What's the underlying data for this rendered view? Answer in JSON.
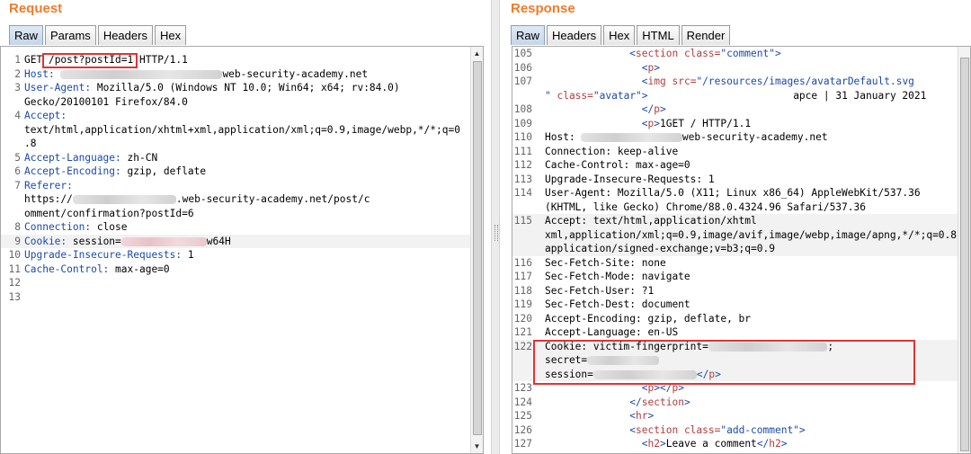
{
  "request": {
    "title": "Request",
    "tabs": [
      "Raw",
      "Params",
      "Headers",
      "Hex"
    ],
    "lines": [
      {
        "n": "1",
        "parts": [
          {
            "t": "GET "
          },
          {
            "t": "/post?postId=1"
          },
          {
            "t": " HTTP/1.1"
          }
        ]
      },
      {
        "n": "2",
        "parts": [
          {
            "t": "Host:",
            "c": "hdr-name"
          },
          {
            "t": " "
          },
          {
            "blur": "360"
          },
          {
            "t": "web-security-academy.net"
          }
        ]
      },
      {
        "n": "3",
        "parts": [
          {
            "t": "User-Agent:",
            "c": "hdr-name"
          },
          {
            "t": " Mozilla/5.0 (Windows NT 10.0; Win64; x64; rv:84.0)"
          }
        ]
      },
      {
        "n": "",
        "parts": [
          {
            "t": "Gecko/20100101 Firefox/84.0"
          }
        ]
      },
      {
        "n": "4",
        "parts": [
          {
            "t": "Accept:",
            "c": "hdr-name"
          }
        ]
      },
      {
        "n": "",
        "parts": [
          {
            "t": "text/html,application/xhtml+xml,application/xml;q=0.9,image/webp,*/*;q=0"
          }
        ]
      },
      {
        "n": "",
        "parts": [
          {
            "t": ".8"
          }
        ]
      },
      {
        "n": "5",
        "parts": [
          {
            "t": "Accept-Language:",
            "c": "hdr-name"
          },
          {
            "t": " zh-CN"
          }
        ]
      },
      {
        "n": "6",
        "parts": [
          {
            "t": "Accept-Encoding:",
            "c": "hdr-name"
          },
          {
            "t": " gzip, deflate"
          }
        ]
      },
      {
        "n": "7",
        "parts": [
          {
            "t": "Referer:",
            "c": "hdr-name"
          }
        ]
      },
      {
        "n": "",
        "parts": [
          {
            "t": "https://"
          },
          {
            "blur": "230"
          },
          {
            "t": ".web-security-academy.net/post/c"
          }
        ]
      },
      {
        "n": "",
        "parts": [
          {
            "t": "omment/confirmation?postId=6"
          }
        ]
      },
      {
        "n": "8",
        "parts": [
          {
            "t": "Connection:",
            "c": "hdr-name"
          },
          {
            "t": " close"
          }
        ]
      },
      {
        "n": "9",
        "alt": true,
        "parts": [
          {
            "t": "Cookie:",
            "c": "hdr-name"
          },
          {
            "t": " session="
          },
          {
            "blur": "190",
            "pink": true
          },
          {
            "t": "w64H"
          }
        ]
      },
      {
        "n": "10",
        "parts": [
          {
            "t": "Upgrade-Insecure-Requests:",
            "c": "hdr-name"
          },
          {
            "t": " 1"
          }
        ]
      },
      {
        "n": "11",
        "parts": [
          {
            "t": "Cache-Control:",
            "c": "hdr-name"
          },
          {
            "t": " max-age=0"
          }
        ]
      },
      {
        "n": "12",
        "parts": []
      },
      {
        "n": "13",
        "parts": []
      }
    ]
  },
  "response": {
    "title": "Response",
    "tabs": [
      "Raw",
      "Headers",
      "Hex",
      "HTML",
      "Render"
    ],
    "lines": [
      {
        "n": "105",
        "parts": [
          {
            "t": "              "
          },
          {
            "t": "<",
            "c": "tag"
          },
          {
            "t": "section ",
            "c": "tagname"
          },
          {
            "t": "class=",
            "c": "attr"
          },
          {
            "t": "\"comment\"",
            "c": "str"
          },
          {
            "t": ">",
            "c": "tag"
          }
        ]
      },
      {
        "n": "106",
        "parts": [
          {
            "t": "                "
          },
          {
            "t": "<",
            "c": "tag"
          },
          {
            "t": "p",
            "c": "tagname"
          },
          {
            "t": ">",
            "c": "tag"
          }
        ]
      },
      {
        "n": "107",
        "parts": [
          {
            "t": "                "
          },
          {
            "t": "<",
            "c": "tag"
          },
          {
            "t": "img ",
            "c": "tagname"
          },
          {
            "t": "src=",
            "c": "attr"
          },
          {
            "t": "\"/resources/images/avatarDefault.svg",
            "c": "str"
          }
        ]
      },
      {
        "n": "",
        "parts": [
          {
            "t": "\"",
            "c": "str"
          },
          {
            "t": " class=",
            "c": "attr"
          },
          {
            "t": "\"avatar\"",
            "c": "str"
          },
          {
            "t": ">",
            "c": "tag"
          },
          {
            "t": "                        apce | 31 January 2021"
          }
        ]
      },
      {
        "n": "108",
        "parts": [
          {
            "t": "                "
          },
          {
            "t": "</",
            "c": "tag"
          },
          {
            "t": "p",
            "c": "tagname"
          },
          {
            "t": ">",
            "c": "tag"
          }
        ]
      },
      {
        "n": "109",
        "parts": [
          {
            "t": "                "
          },
          {
            "t": "<",
            "c": "tag"
          },
          {
            "t": "p",
            "c": "tagname"
          },
          {
            "t": ">",
            "c": "tag"
          },
          {
            "t": "1GET / HTTP/1.1"
          }
        ]
      },
      {
        "n": "110",
        "parts": [
          {
            "t": "Host: "
          },
          {
            "blur": "225"
          },
          {
            "t": "web-security-academy.net"
          }
        ]
      },
      {
        "n": "111",
        "parts": [
          {
            "t": "Connection: keep-alive"
          }
        ]
      },
      {
        "n": "112",
        "parts": [
          {
            "t": "Cache-Control: max-age=0"
          }
        ]
      },
      {
        "n": "113",
        "parts": [
          {
            "t": "Upgrade-Insecure-Requests: 1"
          }
        ]
      },
      {
        "n": "114",
        "parts": [
          {
            "t": "User-Agent: Mozilla/5.0 (X11; Linux x86_64) AppleWebKit/537.36"
          }
        ]
      },
      {
        "n": "",
        "parts": [
          {
            "t": "(KHTML, like Gecko) Chrome/88.0.4324.96 Safari/537.36"
          }
        ]
      },
      {
        "n": "115",
        "alt": true,
        "parts": [
          {
            "t": "Accept: text/html,application/xhtml"
          }
        ]
      },
      {
        "n": "",
        "alt": true,
        "parts": [
          {
            "t": "xml,application/xml;q=0.9,image/avif,image/webp,image/apng,*/*;q=0.8,"
          }
        ]
      },
      {
        "n": "",
        "alt": true,
        "parts": [
          {
            "t": "application/signed-exchange;v=b3;q=0.9"
          }
        ]
      },
      {
        "n": "116",
        "parts": [
          {
            "t": "Sec-Fetch-Site: none"
          }
        ]
      },
      {
        "n": "117",
        "parts": [
          {
            "t": "Sec-Fetch-Mode: navigate"
          }
        ]
      },
      {
        "n": "118",
        "parts": [
          {
            "t": "Sec-Fetch-User: ?1"
          }
        ]
      },
      {
        "n": "119",
        "parts": [
          {
            "t": "Sec-Fetch-Dest: document"
          }
        ]
      },
      {
        "n": "120",
        "parts": [
          {
            "t": "Accept-Encoding: gzip, deflate, br"
          }
        ]
      },
      {
        "n": "121",
        "parts": [
          {
            "t": "Accept-Language: en-US"
          }
        ]
      },
      {
        "n": "122",
        "alt": true,
        "parts": [
          {
            "t": "Cookie: victim-fingerprint="
          },
          {
            "blur": "265"
          },
          {
            "t": ";"
          }
        ]
      },
      {
        "n": "",
        "alt": true,
        "parts": [
          {
            "t": "secret="
          },
          {
            "blur": "160"
          }
        ]
      },
      {
        "n": "",
        "alt": true,
        "parts": [
          {
            "t": "session="
          },
          {
            "blur": "230"
          },
          {
            "t": "</",
            "c": "tag"
          },
          {
            "t": "p",
            "c": "tagname"
          },
          {
            "t": ">",
            "c": "tag"
          }
        ]
      },
      {
        "n": "123",
        "parts": [
          {
            "t": "                "
          },
          {
            "t": "<",
            "c": "tag"
          },
          {
            "t": "p",
            "c": "tagname"
          },
          {
            "t": "></",
            "c": "tag"
          },
          {
            "t": "p",
            "c": "tagname"
          },
          {
            "t": ">",
            "c": "tag"
          }
        ]
      },
      {
        "n": "124",
        "parts": [
          {
            "t": "              "
          },
          {
            "t": "</",
            "c": "tag"
          },
          {
            "t": "section",
            "c": "tagname"
          },
          {
            "t": ">",
            "c": "tag"
          }
        ]
      },
      {
        "n": "125",
        "parts": [
          {
            "t": "              "
          },
          {
            "t": "<",
            "c": "tag"
          },
          {
            "t": "hr",
            "c": "tagname"
          },
          {
            "t": ">",
            "c": "tag"
          }
        ]
      },
      {
        "n": "126",
        "parts": [
          {
            "t": "              "
          },
          {
            "t": "<",
            "c": "tag"
          },
          {
            "t": "section ",
            "c": "tagname"
          },
          {
            "t": "class=",
            "c": "attr"
          },
          {
            "t": "\"add-comment\"",
            "c": "str"
          },
          {
            "t": ">",
            "c": "tag"
          }
        ]
      },
      {
        "n": "127",
        "parts": [
          {
            "t": "                "
          },
          {
            "t": "<",
            "c": "tag"
          },
          {
            "t": "h2",
            "c": "tagname"
          },
          {
            "t": ">",
            "c": "tag"
          },
          {
            "t": "Leave a comment"
          },
          {
            "t": "</",
            "c": "tag"
          },
          {
            "t": "h2",
            "c": "tagname"
          },
          {
            "t": ">",
            "c": "tag"
          }
        ]
      }
    ]
  },
  "colors": {
    "title": "#ee7d2b",
    "highlight_box": "#e23333",
    "header_name": "#1c4aa8"
  }
}
